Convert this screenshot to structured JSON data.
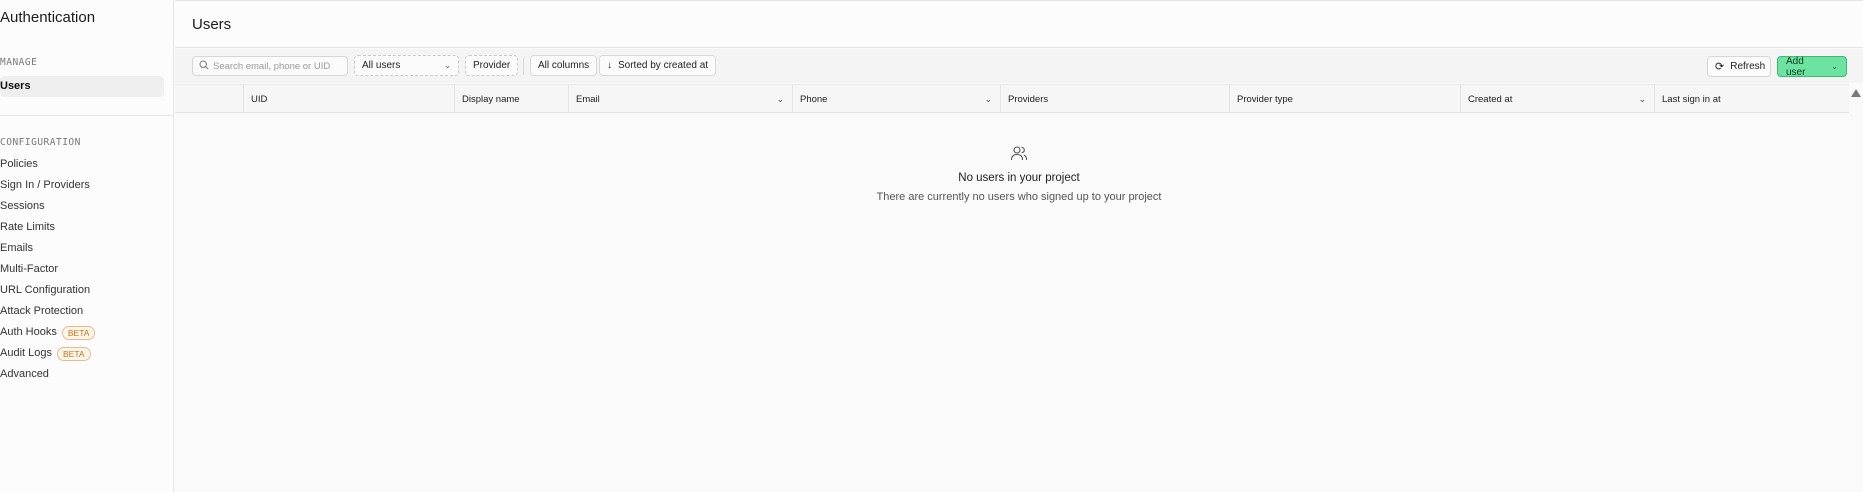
{
  "sidebar": {
    "title": "Authentication",
    "manage_label": "MANAGE",
    "manage_items": [
      {
        "label": "Users",
        "active": true
      }
    ],
    "config_label": "CONFIGURATION",
    "config_items": [
      {
        "label": "Policies"
      },
      {
        "label": "Sign In / Providers"
      },
      {
        "label": "Sessions"
      },
      {
        "label": "Rate Limits"
      },
      {
        "label": "Emails"
      },
      {
        "label": "Multi-Factor"
      },
      {
        "label": "URL Configuration"
      },
      {
        "label": "Attack Protection"
      },
      {
        "label": "Auth Hooks",
        "badge": "BETA"
      },
      {
        "label": "Audit Logs",
        "badge": "BETA"
      },
      {
        "label": "Advanced"
      }
    ]
  },
  "header": {
    "title": "Users"
  },
  "toolbar": {
    "search_placeholder": "Search email, phone or UID",
    "filter_value": "All users",
    "provider_label": "Provider",
    "columns_label": "All columns",
    "sort_label": "Sorted by created at",
    "refresh_label": "Refresh",
    "add_user_label": "Add user"
  },
  "table": {
    "columns": [
      {
        "label": "UID",
        "sortable": false
      },
      {
        "label": "Display name",
        "sortable": false
      },
      {
        "label": "Email",
        "sortable": true
      },
      {
        "label": "Phone",
        "sortable": true
      },
      {
        "label": "Providers",
        "sortable": false
      },
      {
        "label": "Provider type",
        "sortable": false
      },
      {
        "label": "Created at",
        "sortable": true
      },
      {
        "label": "Last sign in at",
        "sortable": false
      }
    ]
  },
  "empty_state": {
    "icon": "users-icon",
    "title": "No users in your project",
    "description": "There are currently no users who signed up to your project"
  },
  "colors": {
    "accent": "#6de3a1",
    "badge": "#c9731d"
  }
}
